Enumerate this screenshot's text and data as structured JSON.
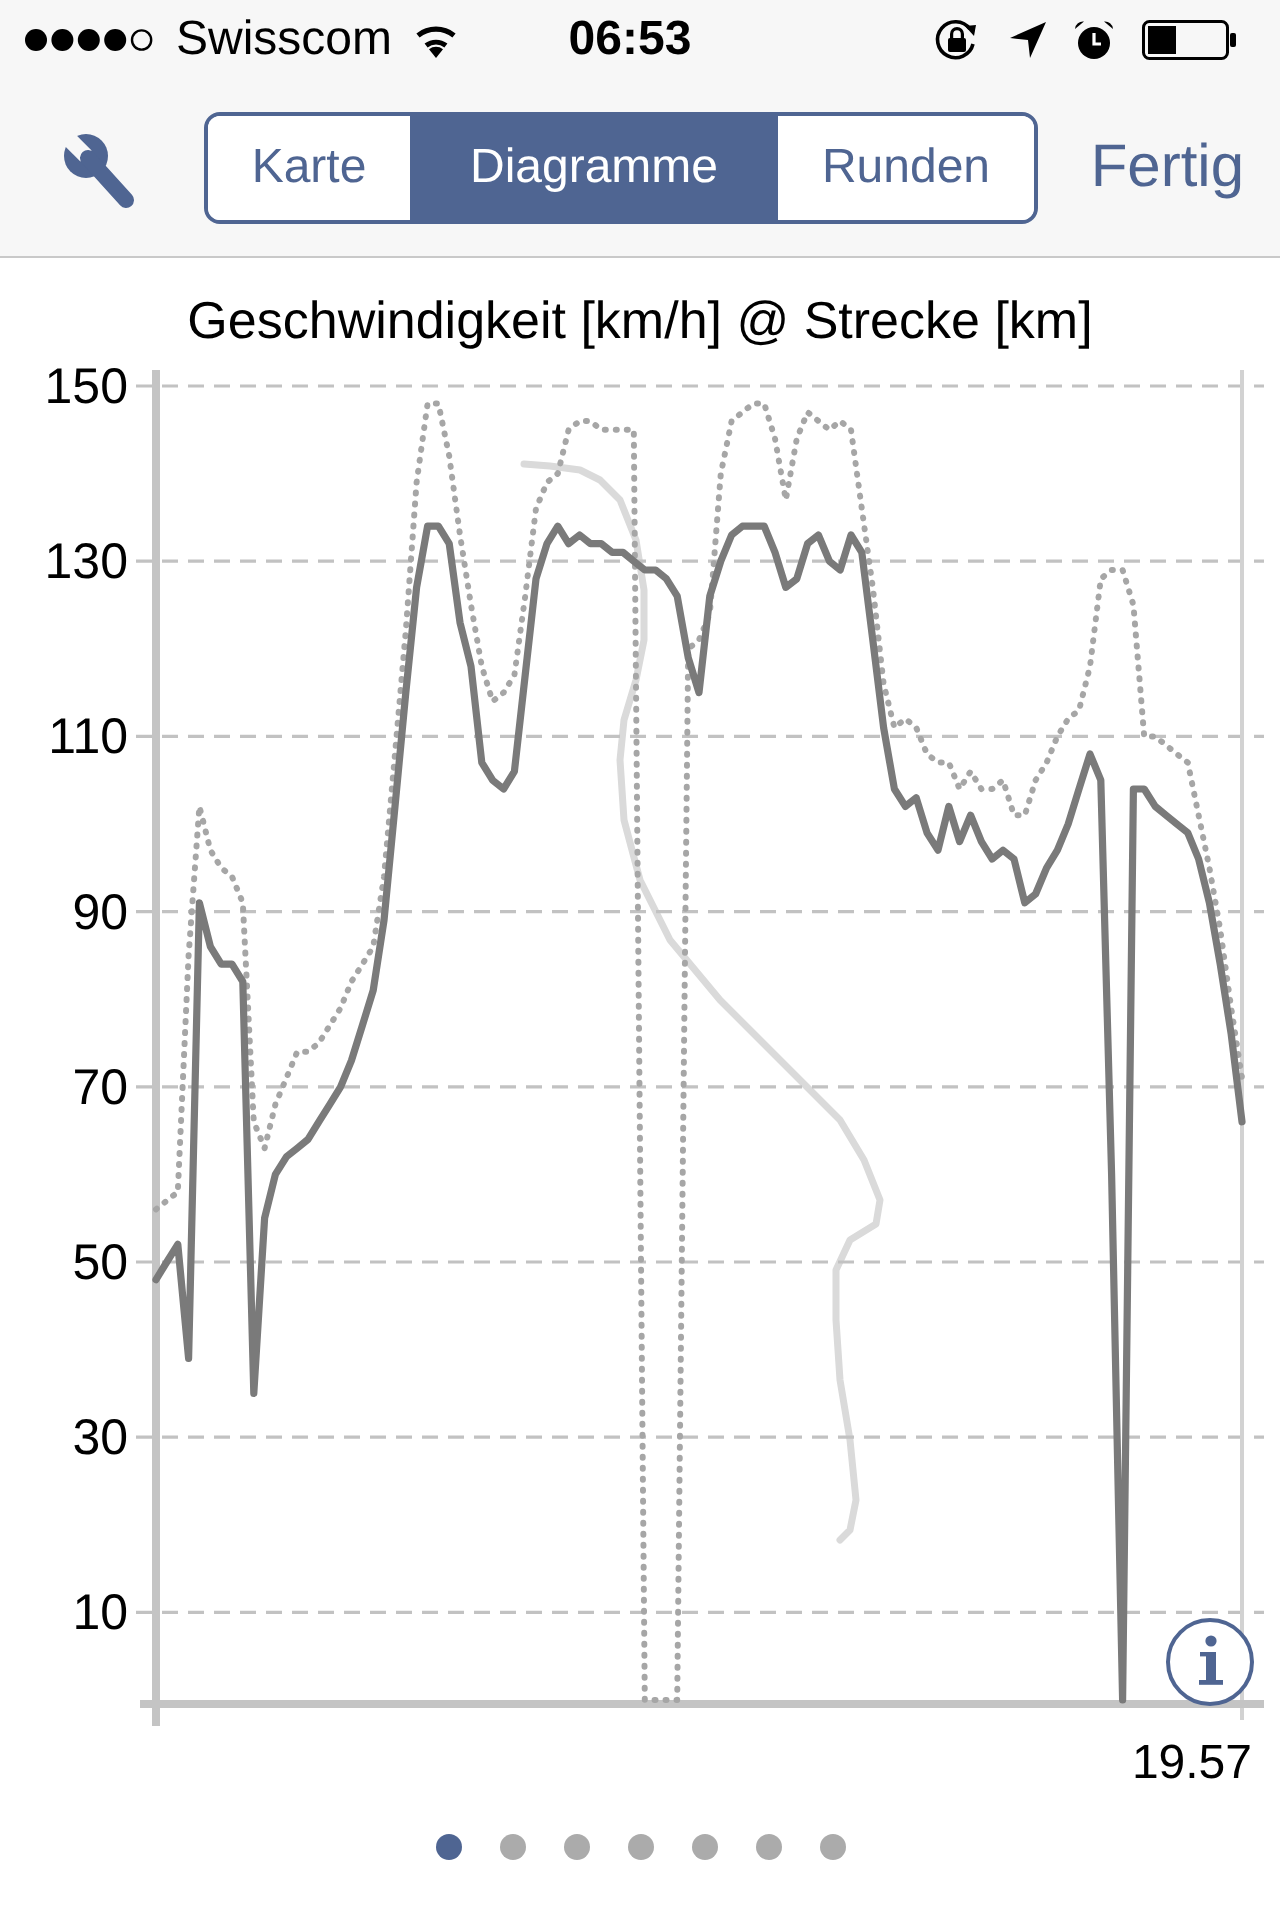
{
  "status_bar": {
    "carrier": "Swisscom",
    "time": "06:53"
  },
  "nav_bar": {
    "tabs": [
      {
        "label": "Karte",
        "selected": false
      },
      {
        "label": "Diagramme",
        "selected": true
      },
      {
        "label": "Runden",
        "selected": false
      }
    ],
    "done_button": "Fertig"
  },
  "chart": {
    "chart_data": {
      "type": "line",
      "title": "Geschwindigkeit [km/h] @ Strecke [km]",
      "grid": true,
      "ylim": [
        0,
        150
      ],
      "yticks": [
        {
          "value": 10,
          "label": "10"
        },
        {
          "value": 30,
          "label": "30"
        },
        {
          "value": 50,
          "label": "50"
        },
        {
          "value": 70,
          "label": "70"
        },
        {
          "value": 90,
          "label": "90"
        },
        {
          "value": 110,
          "label": "110"
        },
        {
          "value": 130,
          "label": "130"
        },
        {
          "value": 150,
          "label": "150"
        }
      ],
      "series": [
        {
          "color": "#a6a6a6",
          "line_style": "dotted",
          "values": [
            56,
            57,
            58,
            85,
            102,
            97,
            95,
            94,
            91,
            66,
            63,
            68,
            71,
            74,
            74,
            75,
            77,
            79,
            82,
            84,
            86,
            94,
            108,
            122,
            139,
            148,
            148,
            142,
            133,
            125,
            118,
            114,
            115,
            117,
            126,
            136,
            139,
            140,
            145,
            146,
            146,
            145,
            145,
            145,
            145,
            0,
            0,
            0,
            0,
            120,
            121,
            124,
            140,
            146,
            147,
            148,
            148,
            144,
            137,
            144,
            147,
            146,
            145,
            146,
            145,
            136,
            127,
            116,
            111,
            112,
            111,
            108,
            107,
            107,
            104,
            106,
            104,
            104,
            105,
            101,
            101,
            105,
            107,
            110,
            112,
            113,
            118,
            128,
            129,
            129,
            125,
            110,
            110,
            109,
            108,
            107,
            101,
            95,
            88,
            79,
            71
          ]
        },
        {
          "color": "#7a7a7a",
          "line_style": "solid",
          "values": [
            48,
            50,
            52,
            39,
            91,
            86,
            84,
            84,
            82,
            35,
            55,
            60,
            62,
            63,
            64,
            66,
            68,
            70,
            73,
            77,
            81,
            89,
            102,
            115,
            127,
            134,
            134,
            132,
            123,
            118,
            107,
            105,
            104,
            106,
            117,
            128,
            132,
            134,
            132,
            133,
            132,
            132,
            131,
            131,
            130,
            129,
            129,
            128,
            126,
            119,
            115,
            126,
            130,
            133,
            134,
            134,
            134,
            131,
            127,
            128,
            132,
            133,
            130,
            129,
            133,
            131,
            121,
            111,
            104,
            102,
            103,
            99,
            97,
            102,
            98,
            101,
            98,
            96,
            97,
            96,
            91,
            92,
            95,
            97,
            100,
            104,
            108,
            105,
            60,
            0,
            104,
            104,
            102,
            101,
            100,
            99,
            96,
            91,
            84,
            76,
            66
          ]
        }
      ],
      "annotations": [
        "19.57"
      ]
    }
  },
  "page_indicator": [
    {
      "selected": true
    },
    {
      "selected": false
    },
    {
      "selected": false
    },
    {
      "selected": false
    },
    {
      "selected": false
    },
    {
      "selected": false
    },
    {
      "selected": false
    }
  ]
}
